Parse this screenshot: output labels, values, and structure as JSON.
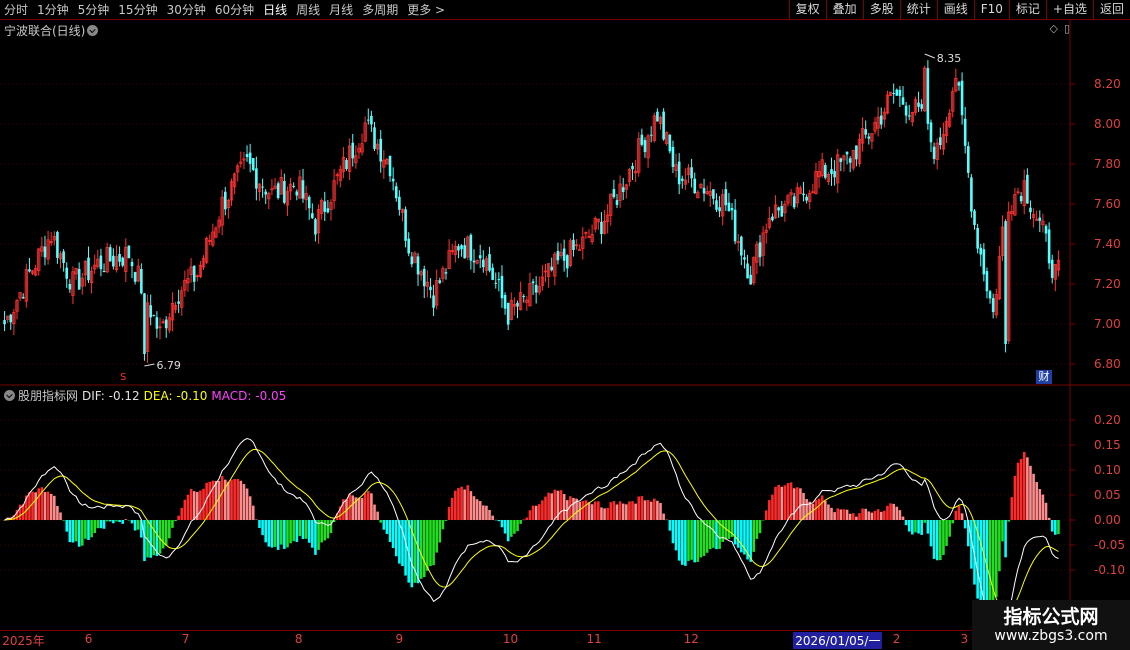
{
  "toolbar": {
    "periods": [
      "分时",
      "1分钟",
      "5分钟",
      "15分钟",
      "30分钟",
      "60分钟",
      "日线",
      "周线",
      "月线",
      "多周期",
      "更多 >"
    ],
    "active_period": "日线",
    "right_buttons": [
      "复权",
      "叠加",
      "多股",
      "统计",
      "画线",
      "F10",
      "标记",
      "+自选",
      "返回"
    ]
  },
  "stock": {
    "title": "宁波联合(日线)",
    "high_marker": "8.35",
    "low_marker": "6.79"
  },
  "indicator": {
    "name": "股朋指标网",
    "dif": "DIF: -0.12",
    "dea": "DEA: -0.10",
    "macd": "MACD: -0.05"
  },
  "badges": {
    "finance": "财",
    "dividend": "S"
  },
  "dates": [
    {
      "label": "2025年",
      "pos": 0.002
    },
    {
      "label": "6",
      "pos": 0.075
    },
    {
      "label": "7",
      "pos": 0.161
    },
    {
      "label": "8",
      "pos": 0.261
    },
    {
      "label": "9",
      "pos": 0.35
    },
    {
      "label": "10",
      "pos": 0.445
    },
    {
      "label": "11",
      "pos": 0.519
    },
    {
      "label": "12",
      "pos": 0.605
    },
    {
      "label": "2026/01/05/一",
      "pos": 0.702,
      "selected": true
    },
    {
      "label": "2",
      "pos": 0.79
    },
    {
      "label": "3",
      "pos": 0.85
    }
  ],
  "watermark": {
    "title": "指标公式网",
    "url": "www.zbgs3.com"
  },
  "colors": {
    "up": "#ff3232",
    "down": "#54ffff",
    "grid": "#7a0000",
    "dif": "#ffffff",
    "dea": "#ffff00",
    "macd_pos_strong": "#ff2a2a",
    "macd_pos_weak": "#ff8c8c",
    "macd_neg_strong": "#00ffff",
    "macd_neg_weak": "#20e020",
    "axis_text": "#e04040"
  },
  "chart_data": [
    {
      "type": "candlestick",
      "name": "宁波联合(日线)",
      "ylim": [
        6.72,
        8.42
      ],
      "yticks": [
        6.8,
        7.0,
        7.2,
        7.4,
        7.6,
        7.8,
        8.0,
        8.2
      ],
      "close_anchors": [
        [
          0,
          7.0
        ],
        [
          8,
          7.25
        ],
        [
          15,
          7.45
        ],
        [
          22,
          7.2
        ],
        [
          30,
          7.3
        ],
        [
          40,
          7.35
        ],
        [
          50,
          6.95
        ],
        [
          55,
          7.15
        ],
        [
          62,
          7.25
        ],
        [
          70,
          7.6
        ],
        [
          78,
          7.8
        ],
        [
          86,
          7.65
        ],
        [
          94,
          7.7
        ],
        [
          100,
          7.5
        ],
        [
          108,
          7.75
        ],
        [
          116,
          8.0
        ],
        [
          124,
          7.8
        ],
        [
          130,
          7.4
        ],
        [
          138,
          7.15
        ],
        [
          146,
          7.4
        ],
        [
          154,
          7.35
        ],
        [
          162,
          7.05
        ],
        [
          170,
          7.15
        ],
        [
          178,
          7.3
        ],
        [
          186,
          7.4
        ],
        [
          194,
          7.55
        ],
        [
          202,
          7.8
        ],
        [
          210,
          8.05
        ],
        [
          216,
          7.75
        ],
        [
          224,
          7.7
        ],
        [
          232,
          7.6
        ],
        [
          240,
          7.25
        ],
        [
          246,
          7.55
        ],
        [
          254,
          7.6
        ],
        [
          262,
          7.75
        ],
        [
          270,
          7.8
        ],
        [
          278,
          7.95
        ],
        [
          286,
          8.15
        ],
        [
          294,
          8.05
        ],
        [
          300,
          7.85
        ],
        [
          306,
          8.25
        ],
        [
          312,
          7.5
        ],
        [
          318,
          7.05
        ],
        [
          322,
          7.6
        ],
        [
          328,
          7.7
        ],
        [
          334,
          7.45
        ],
        [
          338,
          7.25
        ]
      ],
      "markers": {
        "high": 8.35,
        "low": 6.79
      }
    },
    {
      "type": "macd",
      "name": "股朋指标网",
      "ylim": [
        -0.19,
        0.25
      ],
      "yticks": [
        0.2,
        0.15,
        0.1,
        0.05,
        0.0,
        -0.05,
        -0.1
      ],
      "dif_last": -0.12,
      "dea_last": -0.1,
      "macd_last": -0.05
    }
  ]
}
